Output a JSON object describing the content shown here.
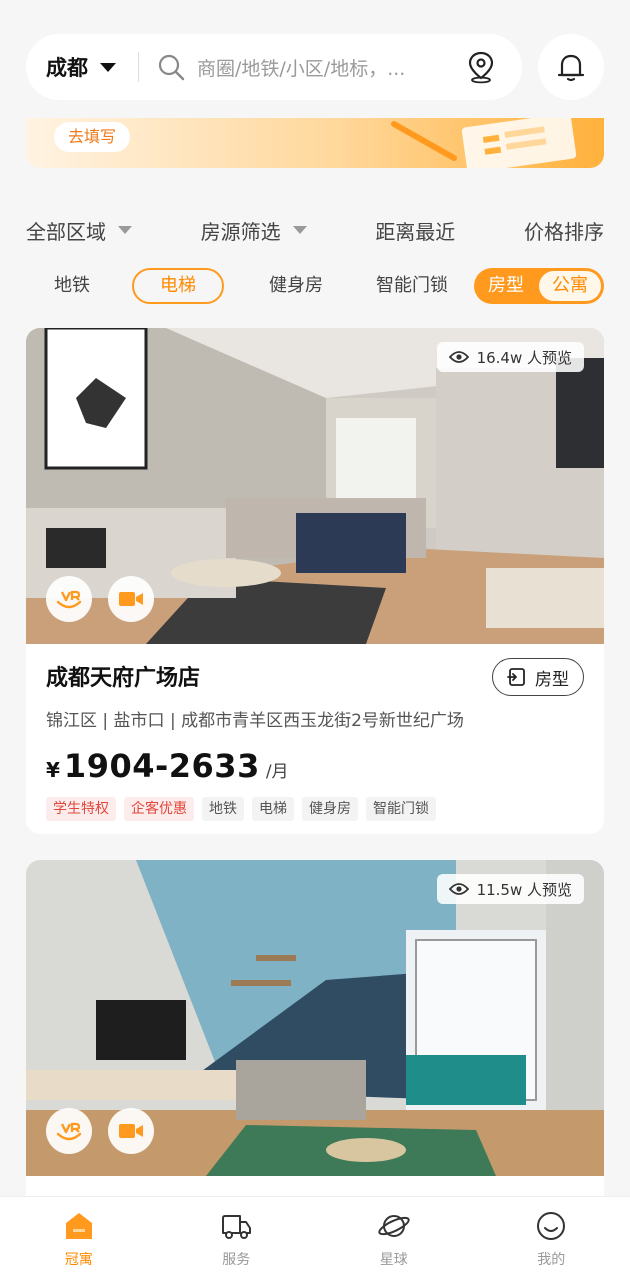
{
  "header": {
    "city": "成都",
    "search_placeholder": "商圈/地铁/小区/地标，..."
  },
  "banner": {
    "button_label": "去填写"
  },
  "sort_bar": {
    "items": [
      {
        "label": "全部区域",
        "has_dropdown": true
      },
      {
        "label": "房源筛选",
        "has_dropdown": true
      },
      {
        "label": "距离最近",
        "has_dropdown": false
      },
      {
        "label": "价格排序",
        "has_dropdown": false
      }
    ]
  },
  "filter_chips": {
    "items": [
      "地铁",
      "电梯",
      "健身房",
      "智能门锁"
    ],
    "selected": "电梯",
    "toggle": {
      "left": "房型",
      "right": "公寓",
      "active": "公寓"
    }
  },
  "listings": [
    {
      "views": "16.4w 人预览",
      "title": "成都天府广场店",
      "floorplan_label": "房型",
      "address": "锦江区 | 盐市口 | 成都市青羊区西玉龙街2号新世纪广场",
      "currency": "¥",
      "price": "1904-2633",
      "unit": "/月",
      "tags": [
        {
          "text": "学生特权",
          "style": "red"
        },
        {
          "text": "企客优惠",
          "style": "red"
        },
        {
          "text": "地铁",
          "style": "gray"
        },
        {
          "text": "电梯",
          "style": "gray"
        },
        {
          "text": "健身房",
          "style": "gray"
        },
        {
          "text": "智能门锁",
          "style": "gray"
        }
      ]
    },
    {
      "views": "11.5w 人预览"
    }
  ],
  "bottom_nav": {
    "items": [
      {
        "label": "冠寓",
        "icon": "home-icon",
        "active": true
      },
      {
        "label": "服务",
        "icon": "service-truck-icon",
        "active": false
      },
      {
        "label": "星球",
        "icon": "planet-icon",
        "active": false
      },
      {
        "label": "我的",
        "icon": "smiley-icon",
        "active": false
      }
    ]
  },
  "colors": {
    "accent": "#ff9a1f",
    "accent_text": "#ff8a00",
    "tag_red": "#e2473b"
  }
}
